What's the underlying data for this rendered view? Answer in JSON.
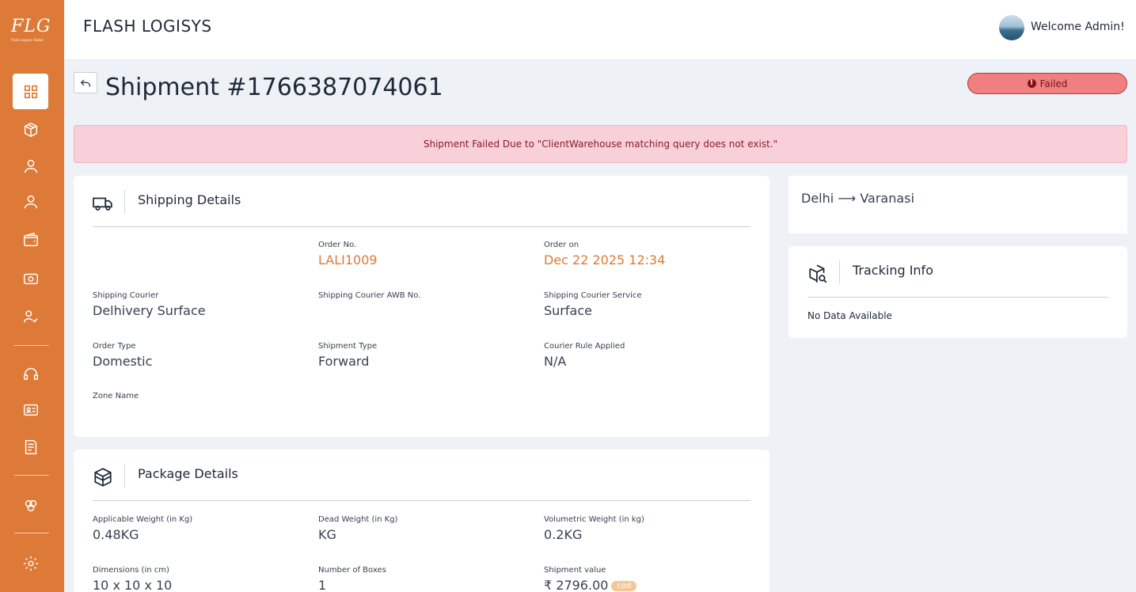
{
  "sidebar": {
    "logo_text": "FLG",
    "logo_tagline": "Flash Logisys Global",
    "items": [
      {
        "icon": "dashboard-icon",
        "active": true
      },
      {
        "icon": "box-icon"
      },
      {
        "icon": "user-icon"
      },
      {
        "icon": "user-icon"
      },
      {
        "icon": "wallet-icon"
      },
      {
        "icon": "money-icon"
      },
      {
        "icon": "user-check-icon"
      },
      {
        "icon": "headset-icon"
      },
      {
        "icon": "id-card-icon"
      },
      {
        "icon": "report-icon"
      },
      {
        "icon": "integrations-icon"
      },
      {
        "icon": "settings-icon"
      }
    ]
  },
  "header": {
    "brand": "FLASH LOGISYS",
    "welcome": "Welcome Admin!"
  },
  "page": {
    "title": "Shipment #1766387074061",
    "status": "Failed",
    "alert": "Shipment Failed Due to \"ClientWarehouse matching query does not exist.\""
  },
  "shipping_details": {
    "title": "Shipping Details",
    "order_no_label": "Order No.",
    "order_no": "LALI1009",
    "order_on_label": "Order on",
    "order_on": "Dec 22 2025 12:34",
    "courier_label": "Shipping Courier",
    "courier": "Delhivery Surface",
    "awb_label": "Shipping Courier AWB No.",
    "awb": "",
    "service_label": "Shipping Courier Service",
    "service": "Surface",
    "order_type_label": "Order Type",
    "order_type": "Domestic",
    "shipment_type_label": "Shipment Type",
    "shipment_type": "Forward",
    "rule_label": "Courier Rule Applied",
    "rule": "N/A",
    "zone_label": "Zone Name",
    "zone": ""
  },
  "package_details": {
    "title": "Package Details",
    "applicable_weight_label": "Applicable Weight (in Kg)",
    "applicable_weight": "0.48KG",
    "dead_weight_label": "Dead Weight (in Kg)",
    "dead_weight": "KG",
    "volumetric_weight_label": "Volumetric Weight (in kg)",
    "volumetric_weight": "0.2KG",
    "dimensions_label": "Dimensions (in cm)",
    "dimensions": "10 x 10 x 10",
    "boxes_label": "Number of Boxes",
    "boxes": "1",
    "value_label": "Shipment value",
    "value": "₹ 2796.00",
    "payment_badge": "cod"
  },
  "route": {
    "from": "Delhi",
    "arrow": "⟶",
    "to": "Varanasi"
  },
  "tracking": {
    "title": "Tracking Info",
    "empty": "No Data Available"
  },
  "colors": {
    "accent": "#dd7a37",
    "failed_bg": "#f08080",
    "alert_bg": "#f8d0d9"
  }
}
